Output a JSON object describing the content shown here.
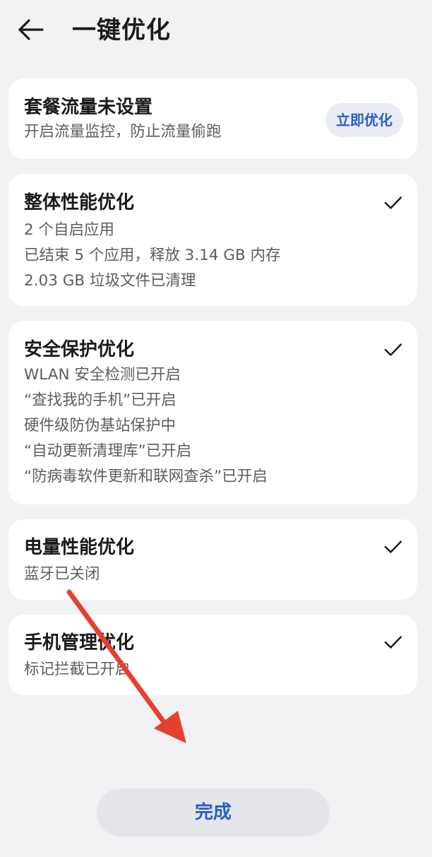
{
  "header": {
    "title": "一键优化",
    "back_icon": "back-arrow-icon"
  },
  "cards": {
    "data_plan": {
      "title": "套餐流量未设置",
      "lines": [
        "开启流量监控，防止流量偷跑"
      ],
      "action_label": "立即优化"
    },
    "performance": {
      "title": "整体性能优化",
      "lines": [
        "2 个自启应用",
        "已结束 5 个应用，释放 3.14 GB 内存",
        "2.03 GB 垃圾文件已清理"
      ],
      "status_icon": "checkmark-icon"
    },
    "security": {
      "title": "安全保护优化",
      "lines": [
        "WLAN 安全检测已开启",
        "“查找我的手机”已开启",
        "硬件级防伪基站保护中",
        "“自动更新清理库”已开启",
        "“防病毒软件更新和联网查杀”已开启"
      ],
      "status_icon": "checkmark-icon"
    },
    "battery": {
      "title": "电量性能优化",
      "lines": [
        "蓝牙已关闭"
      ],
      "status_icon": "checkmark-icon"
    },
    "phone_manager": {
      "title": "手机管理优化",
      "lines": [
        "标记拦截已开启"
      ],
      "status_icon": "checkmark-icon"
    }
  },
  "footer": {
    "done_label": "完成"
  },
  "annotation": {
    "icon": "red-arrow-annotation",
    "color": "#e5412f"
  },
  "colors": {
    "accent": "#2a5cc9",
    "background": "#f1f2f4",
    "card": "#ffffff"
  }
}
